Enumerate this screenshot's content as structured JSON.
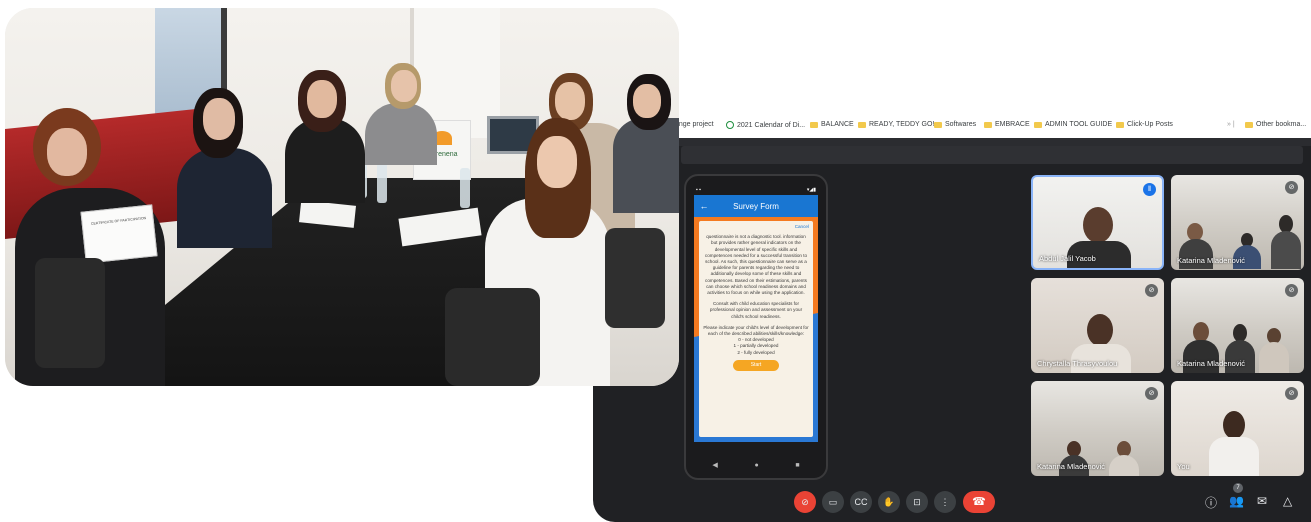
{
  "bookmarks": [
    {
      "label": "ange project",
      "icon": "none"
    },
    {
      "label": "2021 Calendar of Di...",
      "icon": "calendar-icon"
    },
    {
      "label": "BALANCE",
      "icon": "folder-icon"
    },
    {
      "label": "READY, TEDDY GO!",
      "icon": "folder-icon"
    },
    {
      "label": "Softwares",
      "icon": "folder-icon"
    },
    {
      "label": "EMBRACE",
      "icon": "folder-icon"
    },
    {
      "label": "ADMIN TOOL GUIDE",
      "icon": "folder-icon"
    },
    {
      "label": "Click-Up Posts",
      "icon": "folder-icon"
    },
    {
      "label": "Other bookma...",
      "icon": "folder-icon"
    }
  ],
  "phone": {
    "title": "Survey Form",
    "back_icon": "arrow-left-icon",
    "cancel_label": "Cancel",
    "paragraphs": [
      "questionnaire is not a diagnostic tool. information but provides rather general indicators on the developmental level of specific skills and competences needed for a successful transition to school. As such, this questionnaire can serve as a guideline for parents regarding the need to additionally develop some of these skills and competences. Based on their estimations, parents can choose which school readiness domains and activities to focus on while using the application.",
      "Consult with child education specialists for professional opinion and assessment on your child's school readiness.",
      "Please indicate your child's level of development for each of the described abilities/skills/knowledge:"
    ],
    "scale": [
      "0 - not developed",
      "1 - partially developed",
      "2 - fully developed"
    ],
    "start_label": "Start"
  },
  "participants": [
    {
      "name": "Abdul Jalil Yacob",
      "mic": "speaking"
    },
    {
      "name": "Katarina Mladenović",
      "mic": "muted"
    },
    {
      "name": "Chrystalla Thrasyvoulou",
      "mic": "muted"
    },
    {
      "name": "Katarina Mladenović",
      "mic": "muted"
    },
    {
      "name": "Katarina Mladenović",
      "mic": "muted"
    },
    {
      "name": "You",
      "mic": "muted"
    }
  ],
  "toolbar": {
    "people_count": "7"
  },
  "photo": {
    "bag_text": "serenena",
    "certificate_text": "CERTIFICATE OF PARTICIPATION"
  },
  "colors": {
    "meet_bg": "#202124",
    "app_blue": "#1976d2",
    "orange": "#f47a20",
    "end_call_red": "#ea4335",
    "active_speaker": "#8ab4f8"
  }
}
